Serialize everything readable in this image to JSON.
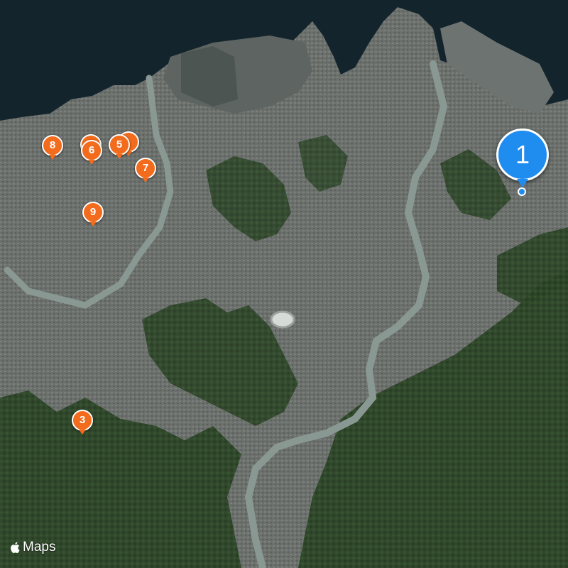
{
  "map": {
    "style": "satellite",
    "attribution": "Maps",
    "attribution_icon": "apple-logo-icon",
    "colors": {
      "sea": "#13242c",
      "urban": "#6e7370",
      "forest": "#2f4a2a",
      "river": "#8a9894",
      "pin_orange": "#f36b1c",
      "pin_blue": "#1f8cf0"
    }
  },
  "markers": [
    {
      "id": "m1",
      "label": "1",
      "color": "#1f8cf0",
      "style": "large"
    },
    {
      "id": "m3",
      "label": "3",
      "color": "#f36b1c",
      "style": "small"
    },
    {
      "id": "m5",
      "label": "5",
      "color": "#f36b1c",
      "style": "small"
    },
    {
      "id": "m6",
      "label": "6",
      "color": "#f36b1c",
      "style": "small"
    },
    {
      "id": "m7",
      "label": "7",
      "color": "#f36b1c",
      "style": "small"
    },
    {
      "id": "m8",
      "label": "8",
      "color": "#f36b1c",
      "style": "small"
    },
    {
      "id": "m9",
      "label": "9",
      "color": "#f36b1c",
      "style": "small"
    }
  ]
}
